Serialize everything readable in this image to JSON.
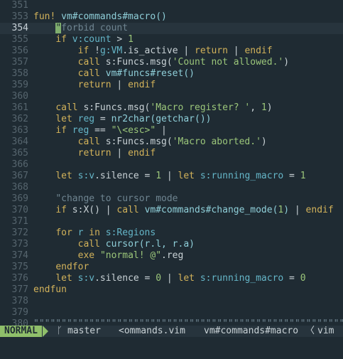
{
  "lines": [
    {
      "n": "351",
      "t": []
    },
    {
      "n": "352",
      "t": []
    },
    {
      "n": "353",
      "t": [
        {
          "c": "kw",
          "s": "fun! "
        },
        {
          "c": "fn",
          "s": "vm#commands#macro()"
        }
      ]
    },
    {
      "n": "353",
      "t": []
    },
    {
      "n": "354",
      "cursor": true,
      "t": [
        {
          "c": "",
          "s": "    "
        },
        {
          "c": "cur",
          "s": "\""
        },
        {
          "c": "cm",
          "s": "forbid count"
        }
      ]
    },
    {
      "n": "355",
      "t": [
        {
          "c": "",
          "s": "    "
        },
        {
          "c": "kw",
          "s": "if "
        },
        {
          "c": "var",
          "s": "v:count"
        },
        {
          "c": "",
          "s": " > "
        },
        {
          "c": "num",
          "s": "1"
        }
      ]
    },
    {
      "n": "356",
      "t": [
        {
          "c": "",
          "s": "        "
        },
        {
          "c": "kw",
          "s": "if "
        },
        {
          "c": "",
          "s": "!"
        },
        {
          "c": "var",
          "s": "g:VM"
        },
        {
          "c": "",
          "s": ".is_active | "
        },
        {
          "c": "kw",
          "s": "return"
        },
        {
          "c": "",
          "s": " | "
        },
        {
          "c": "kw",
          "s": "endif"
        }
      ]
    },
    {
      "n": "357",
      "t": [
        {
          "c": "",
          "s": "        "
        },
        {
          "c": "kw",
          "s": "call "
        },
        {
          "c": "",
          "s": "s:Funcs.msg("
        },
        {
          "c": "str",
          "s": "'Count not allowed.'"
        },
        {
          "c": "",
          "s": ")"
        }
      ]
    },
    {
      "n": "358",
      "t": [
        {
          "c": "",
          "s": "        "
        },
        {
          "c": "kw",
          "s": "call "
        },
        {
          "c": "fn",
          "s": "vm#funcs#reset()"
        }
      ]
    },
    {
      "n": "359",
      "t": [
        {
          "c": "",
          "s": "        "
        },
        {
          "c": "kw",
          "s": "return"
        },
        {
          "c": "",
          "s": " | "
        },
        {
          "c": "kw",
          "s": "endif"
        }
      ]
    },
    {
      "n": "360",
      "t": []
    },
    {
      "n": "361",
      "t": [
        {
          "c": "",
          "s": "    "
        },
        {
          "c": "kw",
          "s": "call "
        },
        {
          "c": "",
          "s": "s:Funcs.msg("
        },
        {
          "c": "str",
          "s": "'Macro register? '"
        },
        {
          "c": "",
          "s": ", "
        },
        {
          "c": "num",
          "s": "1"
        },
        {
          "c": "",
          "s": ")"
        }
      ]
    },
    {
      "n": "362",
      "t": [
        {
          "c": "",
          "s": "    "
        },
        {
          "c": "kw",
          "s": "let "
        },
        {
          "c": "var",
          "s": "reg"
        },
        {
          "c": "",
          "s": " = "
        },
        {
          "c": "fn",
          "s": "nr2char(getchar())"
        }
      ]
    },
    {
      "n": "363",
      "t": [
        {
          "c": "",
          "s": "    "
        },
        {
          "c": "kw",
          "s": "if "
        },
        {
          "c": "var",
          "s": "reg"
        },
        {
          "c": "",
          "s": " == "
        },
        {
          "c": "str",
          "s": "\"\\<esc>\""
        },
        {
          "c": "",
          "s": " |"
        }
      ]
    },
    {
      "n": "364",
      "t": [
        {
          "c": "",
          "s": "        "
        },
        {
          "c": "kw",
          "s": "call "
        },
        {
          "c": "",
          "s": "s:Funcs.msg("
        },
        {
          "c": "str",
          "s": "'Macro aborted.'"
        },
        {
          "c": "",
          "s": ")"
        }
      ]
    },
    {
      "n": "365",
      "t": [
        {
          "c": "",
          "s": "        "
        },
        {
          "c": "kw",
          "s": "return"
        },
        {
          "c": "",
          "s": " | "
        },
        {
          "c": "kw",
          "s": "endif"
        }
      ]
    },
    {
      "n": "366",
      "t": []
    },
    {
      "n": "367",
      "t": [
        {
          "c": "",
          "s": "    "
        },
        {
          "c": "kw",
          "s": "let "
        },
        {
          "c": "var",
          "s": "s:v"
        },
        {
          "c": "",
          "s": ".silence = "
        },
        {
          "c": "num",
          "s": "1"
        },
        {
          "c": "",
          "s": " | "
        },
        {
          "c": "kw",
          "s": "let "
        },
        {
          "c": "var",
          "s": "s:running_macro"
        },
        {
          "c": "",
          "s": " = "
        },
        {
          "c": "num",
          "s": "1"
        }
      ]
    },
    {
      "n": "368",
      "t": []
    },
    {
      "n": "369",
      "t": [
        {
          "c": "",
          "s": "    "
        },
        {
          "c": "cm",
          "s": "\"change to cursor mode"
        }
      ]
    },
    {
      "n": "370",
      "t": [
        {
          "c": "",
          "s": "    "
        },
        {
          "c": "kw",
          "s": "if "
        },
        {
          "c": "",
          "s": "s:X() | "
        },
        {
          "c": "kw",
          "s": "call "
        },
        {
          "c": "fn",
          "s": "vm#commands#change_mode("
        },
        {
          "c": "num",
          "s": "1"
        },
        {
          "c": "fn",
          "s": ")"
        },
        {
          "c": "",
          "s": " | "
        },
        {
          "c": "kw",
          "s": "endif"
        }
      ]
    },
    {
      "n": "371",
      "t": []
    },
    {
      "n": "372",
      "t": [
        {
          "c": "",
          "s": "    "
        },
        {
          "c": "kw",
          "s": "for "
        },
        {
          "c": "var",
          "s": "r"
        },
        {
          "c": "kw",
          "s": " in "
        },
        {
          "c": "var",
          "s": "s:Regions"
        }
      ]
    },
    {
      "n": "373",
      "t": [
        {
          "c": "",
          "s": "        "
        },
        {
          "c": "kw",
          "s": "call "
        },
        {
          "c": "fn",
          "s": "cursor(r.l, r.a)"
        }
      ]
    },
    {
      "n": "374",
      "t": [
        {
          "c": "",
          "s": "        "
        },
        {
          "c": "kw",
          "s": "exe "
        },
        {
          "c": "str",
          "s": "\"normal! @\""
        },
        {
          "c": "",
          "s": ".reg"
        }
      ]
    },
    {
      "n": "375",
      "t": [
        {
          "c": "",
          "s": "    "
        },
        {
          "c": "kw",
          "s": "endfor"
        }
      ]
    },
    {
      "n": "376",
      "t": [
        {
          "c": "",
          "s": "    "
        },
        {
          "c": "kw",
          "s": "let "
        },
        {
          "c": "var",
          "s": "s:v"
        },
        {
          "c": "",
          "s": ".silence = "
        },
        {
          "c": "num",
          "s": "0"
        },
        {
          "c": "",
          "s": " | "
        },
        {
          "c": "kw",
          "s": "let "
        },
        {
          "c": "var",
          "s": "s:running_macro"
        },
        {
          "c": "",
          "s": " = "
        },
        {
          "c": "num",
          "s": "0"
        }
      ]
    },
    {
      "n": "377",
      "t": [
        {
          "c": "kw",
          "s": "endfun"
        }
      ]
    },
    {
      "n": "378",
      "t": []
    },
    {
      "n": "379",
      "t": []
    },
    {
      "n": "380",
      "t": [
        {
          "c": "cm",
          "s": "\"\"\"\"\"\"\"\"\"\"\"\"\"\"\"\"\"\"\"\"\"\"\"\"\"\"\"\"\"\"\"\"\"\"\"\"\"\"\"\"\"\"\"\"\"\"\"\"\"\"\"\"\"\"\"\"\"\"\"\"\"\"\"\"\"\"\"\"\"\"\"\"\"\"\"\"\""
        }
      ]
    }
  ],
  "statusline": {
    "mode": "NORMAL",
    "branch_icon": "ᚴ",
    "branch": "master",
    "file": "<ommands.vim",
    "function": "vm#commands#macro",
    "sep_icon": "〈",
    "filetype": "vim"
  },
  "colors": {
    "background": "#1f2b33",
    "keyword": "#d2b25a",
    "string": "#9bc67a",
    "comment": "#6f8591",
    "mode_bg": "#8fbf6a"
  }
}
